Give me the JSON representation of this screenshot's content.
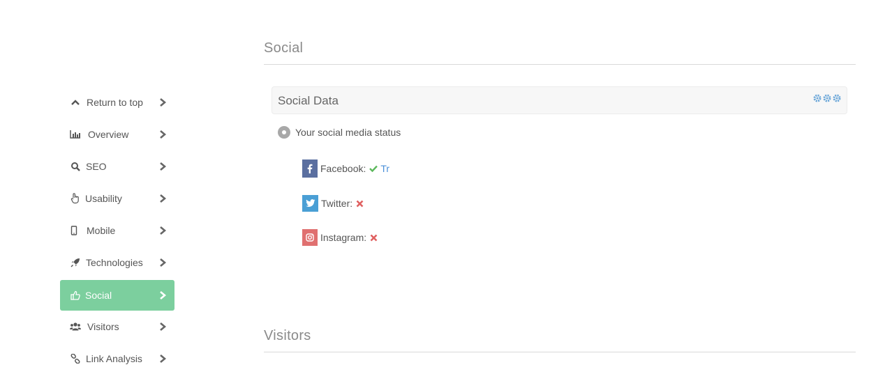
{
  "sidebar": {
    "items": [
      {
        "label": "Return to top",
        "icon": "chevron-up-icon"
      },
      {
        "label": "Overview",
        "icon": "bar-chart-icon"
      },
      {
        "label": "SEO",
        "icon": "search-icon"
      },
      {
        "label": "Usability",
        "icon": "pointer-hand-icon"
      },
      {
        "label": "Mobile",
        "icon": "mobile-phone-icon"
      },
      {
        "label": "Technologies",
        "icon": "rocket-icon"
      },
      {
        "label": "Social",
        "icon": "thumbs-up-icon",
        "active": true
      },
      {
        "label": "Visitors",
        "icon": "users-icon"
      },
      {
        "label": "Link Analysis",
        "icon": "link-icon"
      }
    ],
    "active_color": "#7ccf9e"
  },
  "main": {
    "section_social": "Social",
    "panel_title": "Social Data",
    "status_text": "Your social media status",
    "social": [
      {
        "name": "Facebook:",
        "status": "ok",
        "extra": "Tr",
        "color": "#5b6fa0"
      },
      {
        "name": "Twitter:",
        "status": "fail",
        "color": "#4a9fd5"
      },
      {
        "name": "Instagram:",
        "status": "fail",
        "color": "#e07070"
      }
    ],
    "section_visitors": "Visitors"
  }
}
